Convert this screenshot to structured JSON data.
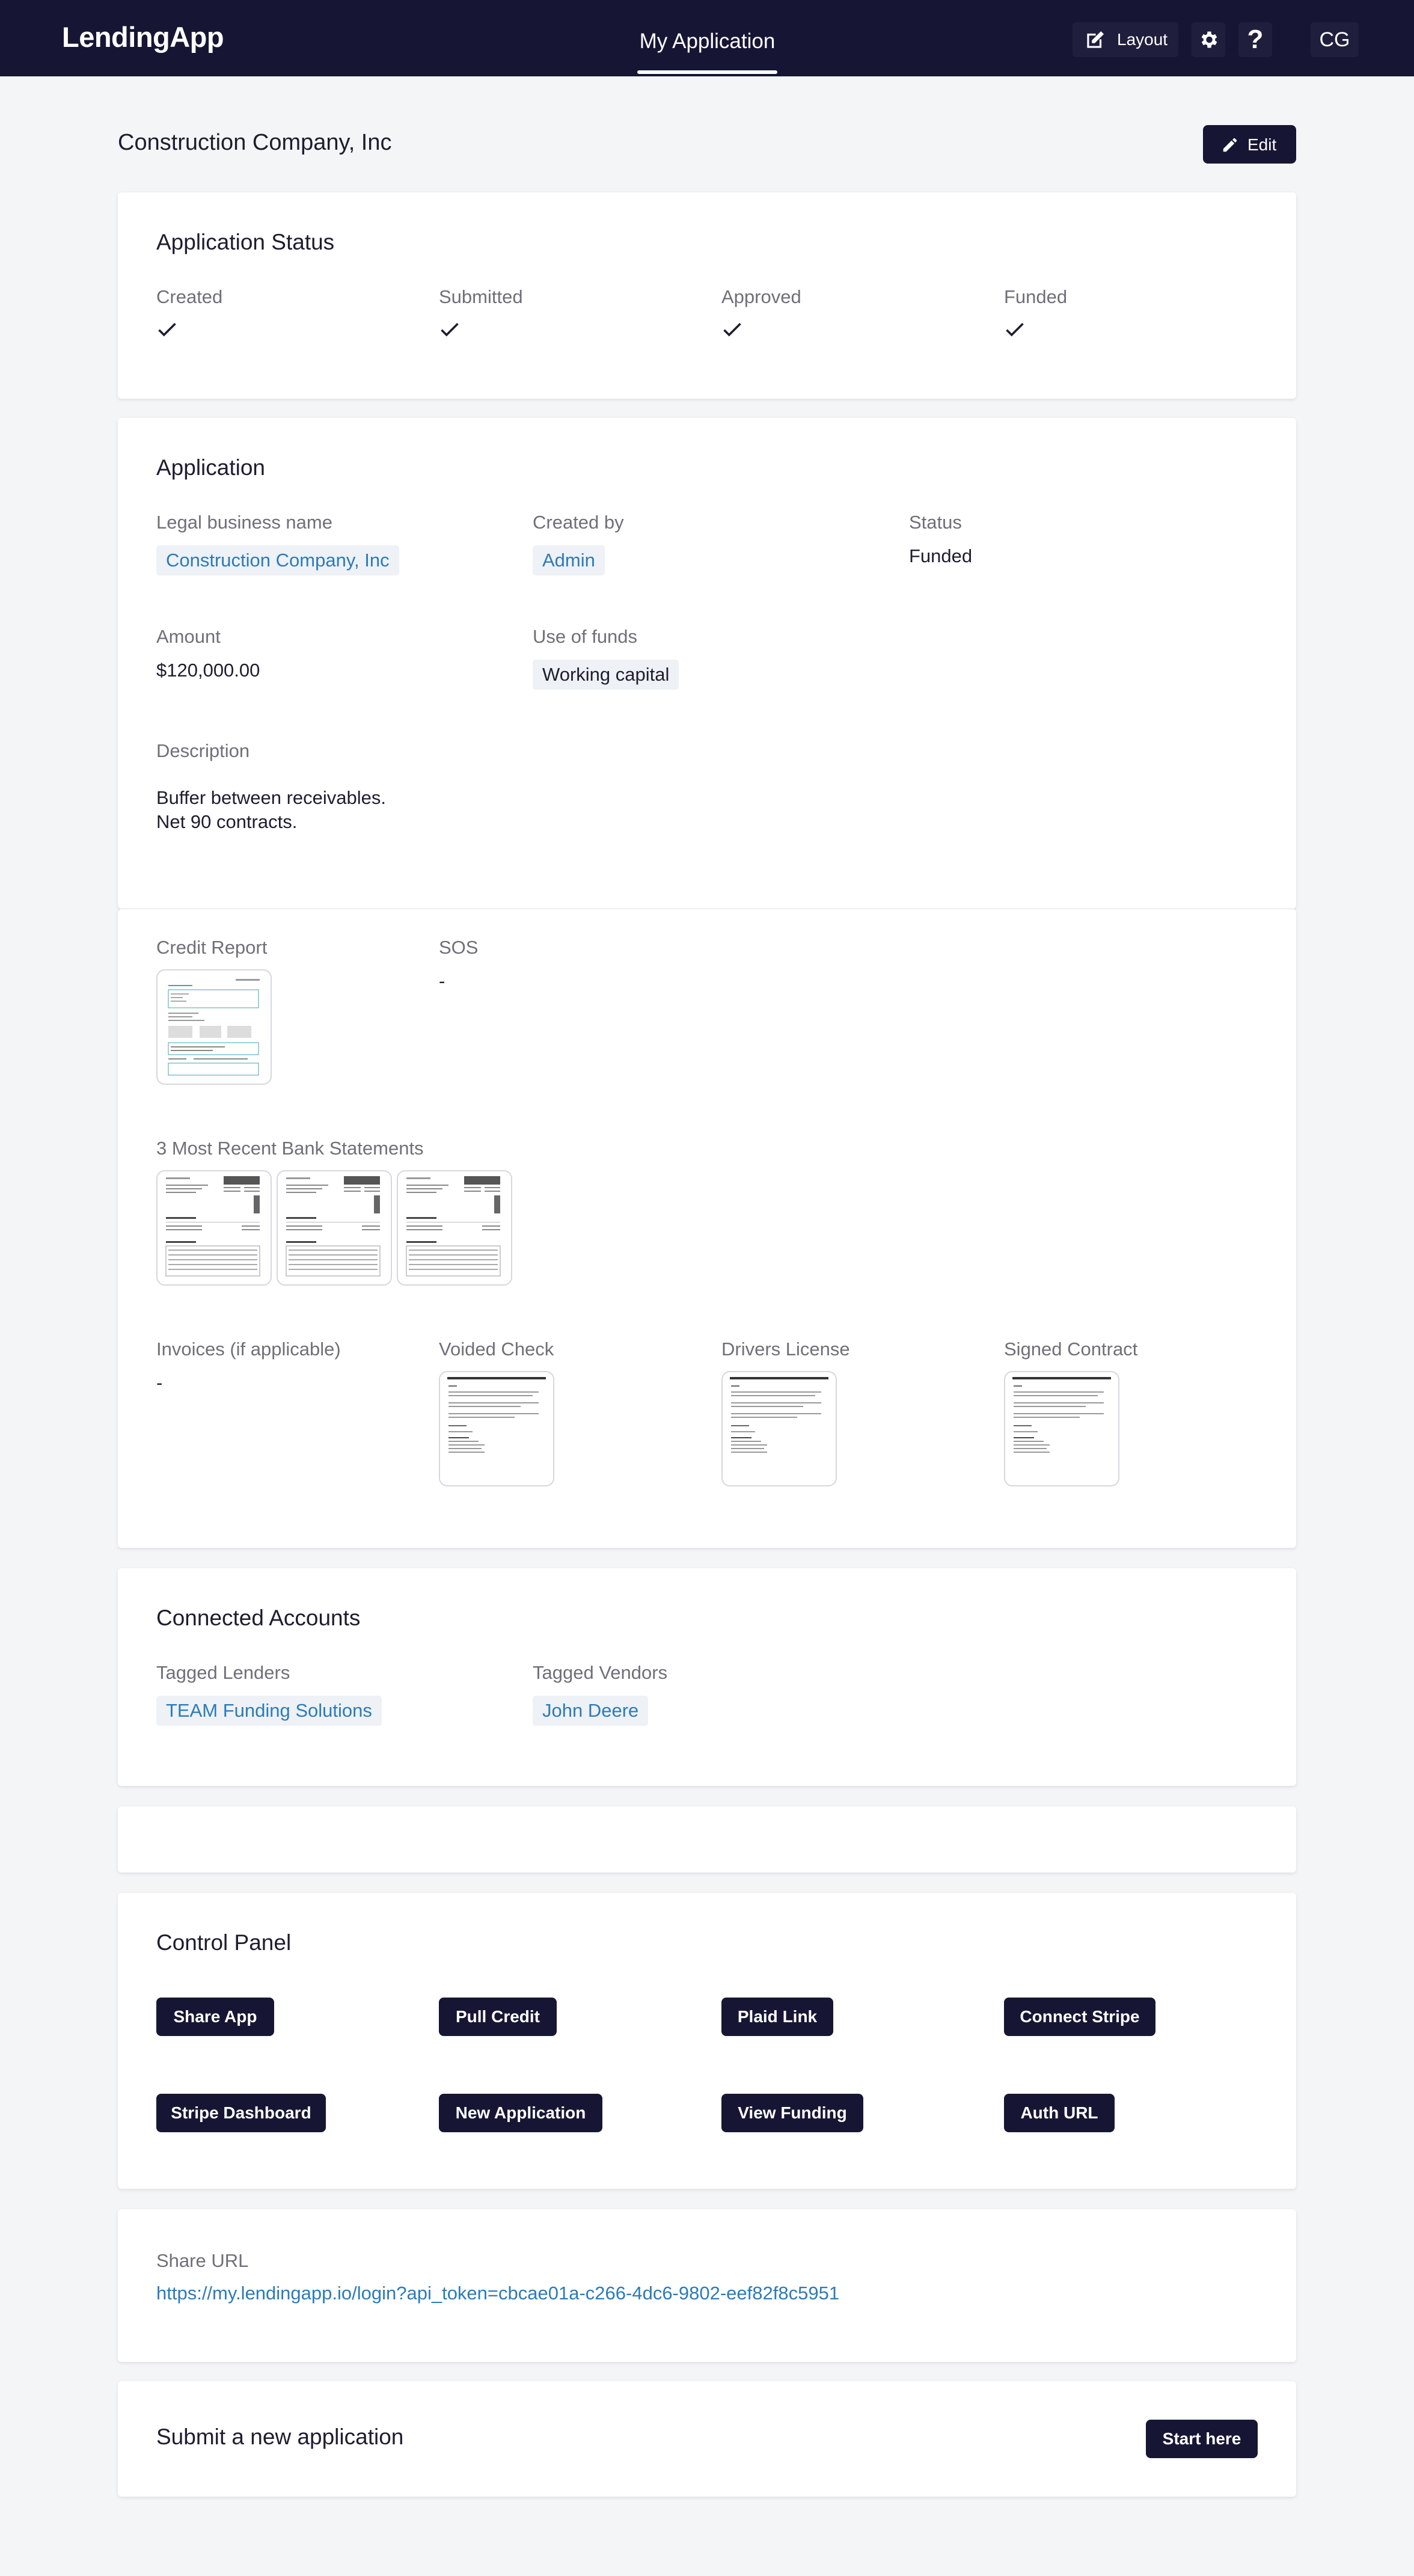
{
  "app": {
    "name": "LendingApp"
  },
  "nav": {
    "active_tab": "My Application",
    "layout_label": "Layout",
    "help_label": "?",
    "user_initials": "CG"
  },
  "page": {
    "title": "Construction Company, Inc",
    "edit_label": "Edit"
  },
  "status_card": {
    "title": "Application Status",
    "steps": [
      {
        "label": "Created",
        "done": true
      },
      {
        "label": "Submitted",
        "done": true
      },
      {
        "label": "Approved",
        "done": true
      },
      {
        "label": "Funded",
        "done": true
      }
    ]
  },
  "application": {
    "title": "Application",
    "legal_name_label": "Legal business name",
    "legal_name": "Construction Company, Inc",
    "created_by_label": "Created by",
    "created_by": "Admin",
    "status_label": "Status",
    "status": "Funded",
    "amount_label": "Amount",
    "amount": "$120,000.00",
    "use_of_funds_label": "Use of funds",
    "use_of_funds": "Working capital",
    "description_label": "Description",
    "description_lines": [
      "Buffer between receivables.",
      "Net 90 contracts."
    ]
  },
  "documents": {
    "credit_report_label": "Credit Report",
    "sos_label": "SOS",
    "sos_value": "-",
    "bank_statements_label": "3 Most Recent Bank Statements",
    "invoices_label": "Invoices (if applicable)",
    "invoices_value": "-",
    "voided_check_label": "Voided Check",
    "drivers_license_label": "Drivers License",
    "signed_contract_label": "Signed Contract"
  },
  "connected": {
    "title": "Connected Accounts",
    "lenders_label": "Tagged Lenders",
    "lender": "TEAM Funding Solutions",
    "vendors_label": "Tagged Vendors",
    "vendor": "John Deere"
  },
  "control_panel": {
    "title": "Control Panel",
    "buttons": [
      "Share App",
      "Pull Credit",
      "Plaid Link",
      "Connect Stripe",
      "Stripe Dashboard",
      "New Application",
      "View Funding",
      "Auth URL"
    ]
  },
  "share": {
    "label": "Share URL",
    "url": "https://my.lendingapp.io/login?api_token=cbcae01a-c266-4dc6-9802-eef82f8c5951"
  },
  "submit": {
    "title": "Submit a new application",
    "button": "Start here"
  },
  "icons": {
    "layout": "edit-square-icon",
    "settings": "gear-icon",
    "edit": "pencil-icon",
    "check": "check-icon"
  },
  "colors": {
    "nav_bg": "#161634",
    "link": "#2c7bb8",
    "page_bg": "#f4f5f7"
  }
}
